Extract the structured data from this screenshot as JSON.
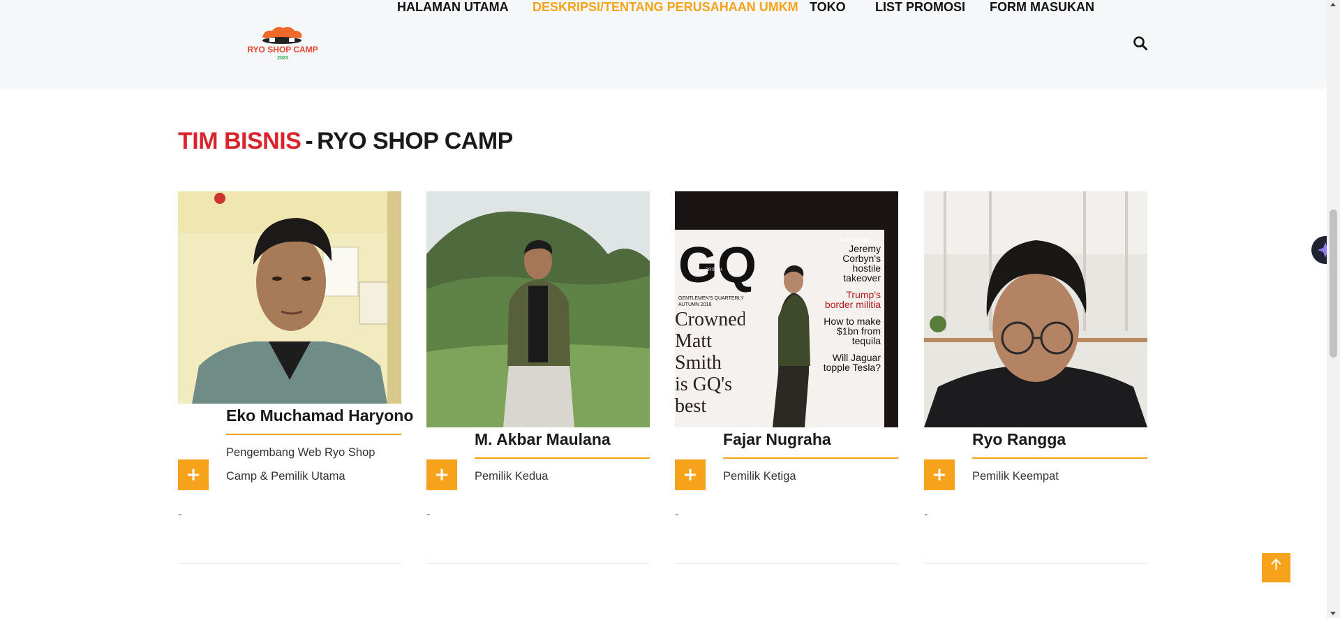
{
  "header": {
    "logo_text": "RYO SHOP CAMP",
    "logo_year": "2023",
    "nav": [
      {
        "label": "HALAMAN UTAMA",
        "active": false
      },
      {
        "label": "DESKRIPSI/TENTANG PERUSAHAAN UMKM",
        "active": true
      },
      {
        "label": "TOKO",
        "active": false
      },
      {
        "label": "LIST PROMOSI",
        "active": false
      },
      {
        "label": "FORM MASUKAN",
        "active": false
      }
    ],
    "search_icon": "search-icon"
  },
  "section": {
    "title_accent": "TIM BISNIS",
    "title_sep": "-",
    "title_main": "RYO SHOP CAMP"
  },
  "team": [
    {
      "name": "Eko Muchamad Haryono",
      "role": "Pengembang Web Ryo Shop Camp & Pemilik Utama",
      "note": "-",
      "plus": "+"
    },
    {
      "name": "M. Akbar Maulana",
      "role": "Pemilik Kedua",
      "note": "-",
      "plus": "+"
    },
    {
      "name": "Fajar Nugraha",
      "role": "Pemilik Ketiga",
      "note": "-",
      "plus": "+"
    },
    {
      "name": "Ryo Rangga",
      "role": "Pemilik Keempat",
      "note": "-",
      "plus": "+"
    }
  ],
  "photo3_magazine": {
    "brand": "GQ",
    "edition": "BRITISH",
    "masthead": "GENTLEMEN'S QUARTERLY",
    "date": "AUTUMN 2018",
    "inside": "ALSO INSIDE:",
    "headline1": "Jeremy Corbyn's hostile takeover",
    "headline2": "Trump's border militia",
    "headline3": "How to make $1bn from tequila",
    "headline4": "Will Jaguar topple Tesla?",
    "cover_text1": "Crowned!",
    "cover_text2": "Matt Smith",
    "cover_text3": "is GQ's best"
  },
  "colors": {
    "accent": "#f7a21b",
    "title_red": "#d9232d",
    "header_bg": "#f6f7f9"
  },
  "floating": {
    "ai_button_icon": "sparkle-icon",
    "to_top_icon": "arrow-up-icon"
  }
}
